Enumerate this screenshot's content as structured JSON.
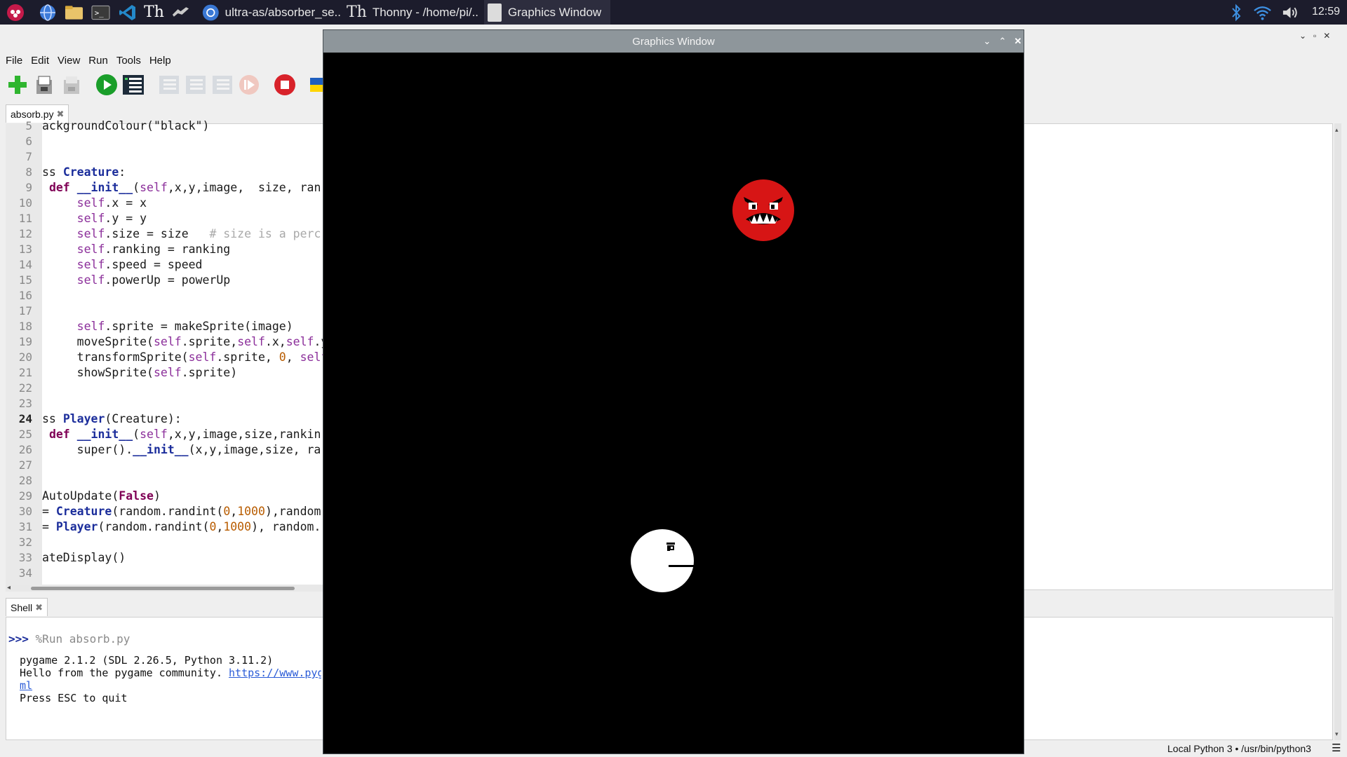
{
  "taskbar": {
    "tasks": [
      {
        "label": "ultra-as/absorber_se..",
        "icon": "chromium-icon"
      },
      {
        "label": "Thonny  -  /home/pi/..",
        "icon": "thonny-icon"
      },
      {
        "label": "Graphics Window",
        "icon": "window-icon"
      }
    ],
    "clock": "12:59"
  },
  "menu": [
    "File",
    "Edit",
    "View",
    "Run",
    "Tools",
    "Help"
  ],
  "editor": {
    "tab_label": "absorb.py",
    "lines": [
      {
        "n": "5",
        "text": "ackgroundColour(\"black\")"
      },
      {
        "n": "6",
        "text": ""
      },
      {
        "n": "7",
        "text": ""
      },
      {
        "n": "8",
        "text": "ss Creature:"
      },
      {
        "n": "9",
        "text": " def __init__(self,x,y,image,  size, ran"
      },
      {
        "n": "10",
        "text": "     self.x = x"
      },
      {
        "n": "11",
        "text": "     self.y = y"
      },
      {
        "n": "12",
        "text": "     self.size = size   # size is a perc"
      },
      {
        "n": "13",
        "text": "     self.ranking = ranking"
      },
      {
        "n": "14",
        "text": "     self.speed = speed"
      },
      {
        "n": "15",
        "text": "     self.powerUp = powerUp"
      },
      {
        "n": "16",
        "text": ""
      },
      {
        "n": "17",
        "text": ""
      },
      {
        "n": "18",
        "text": "     self.sprite = makeSprite(image)"
      },
      {
        "n": "19",
        "text": "     moveSprite(self.sprite,self.x,self.y"
      },
      {
        "n": "20",
        "text": "     transformSprite(self.sprite, 0, self"
      },
      {
        "n": "21",
        "text": "     showSprite(self.sprite)"
      },
      {
        "n": "22",
        "text": ""
      },
      {
        "n": "23",
        "text": ""
      },
      {
        "n": "24",
        "text": "ss Player(Creature):"
      },
      {
        "n": "25",
        "text": " def __init__(self,x,y,image,size,rankin"
      },
      {
        "n": "26",
        "text": "     super().__init__(x,y,image,size, ra"
      },
      {
        "n": "27",
        "text": ""
      },
      {
        "n": "28",
        "text": ""
      },
      {
        "n": "29",
        "text": "AutoUpdate(False)"
      },
      {
        "n": "30",
        "text": "= Creature(random.randint(0,1000),random"
      },
      {
        "n": "31",
        "text": "= Player(random.randint(0,1000), random."
      },
      {
        "n": "32",
        "text": ""
      },
      {
        "n": "33",
        "text": "ateDisplay()"
      },
      {
        "n": "34",
        "text": ""
      }
    ]
  },
  "shell": {
    "tab_label": "Shell",
    "prompt": ">>>",
    "command": "%Run absorb.py",
    "output": [
      "pygame 2.1.2 (SDL 2.26.5, Python 3.11.2)",
      "Hello from the pygame community. "
    ],
    "link": "https://www.pyg",
    "link_cont": "ml",
    "quit_msg": "Press ESC to quit"
  },
  "status": {
    "interpreter": "Local Python 3  •  /usr/bin/python3"
  },
  "graphics_window": {
    "title": "Graphics Window",
    "enemy_color": "#d71515",
    "player_color": "#ffffff"
  }
}
